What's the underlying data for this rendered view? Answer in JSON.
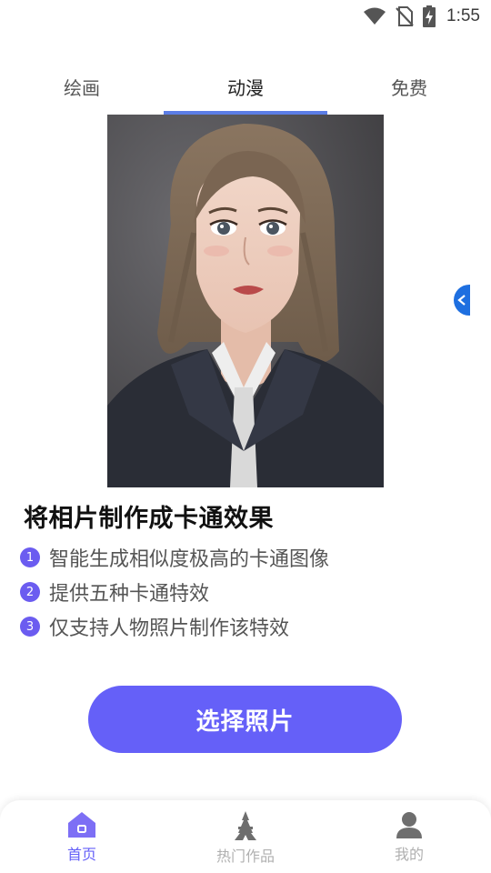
{
  "status_bar": {
    "time": "1:55",
    "icons": [
      "wifi-icon",
      "no-sim-icon",
      "battery-charging-icon"
    ]
  },
  "tabs": [
    {
      "label": "绘画",
      "active": false
    },
    {
      "label": "动漫",
      "active": true
    },
    {
      "label": "免费",
      "active": false
    }
  ],
  "preview": {
    "subject": "anime-style portrait",
    "side_handle_icon": "chevron-left-icon"
  },
  "description": {
    "headline": "将相片制作成卡通效果",
    "features": [
      {
        "num": "1",
        "text": "智能生成相似度极高的卡通图像"
      },
      {
        "num": "2",
        "text": "提供五种卡通特效"
      },
      {
        "num": "3",
        "text": "仅支持人物照片制作该特效"
      }
    ]
  },
  "action": {
    "select_label": "选择照片"
  },
  "bottom_nav": [
    {
      "label": "首页",
      "icon": "home-icon",
      "active": true
    },
    {
      "label": "热门作品",
      "icon": "tower-icon",
      "active": false
    },
    {
      "label": "我的",
      "icon": "user-icon",
      "active": false
    }
  ],
  "colors": {
    "accent": "#6560f8",
    "tab_indicator": "#5b7de6",
    "handle": "#1e6fe0",
    "badge": "#6b5cf0"
  }
}
